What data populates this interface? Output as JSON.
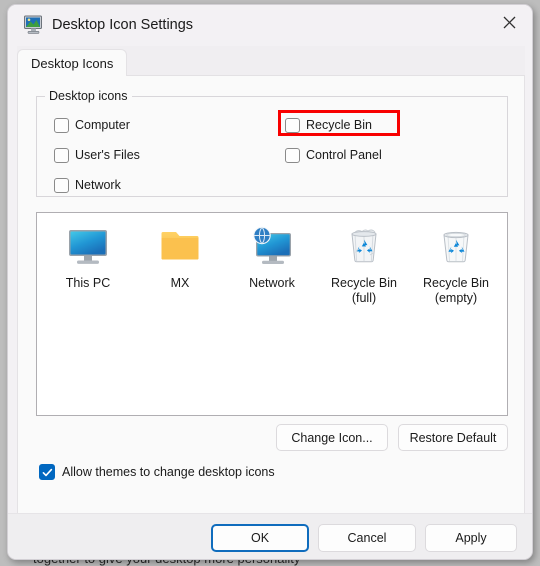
{
  "backdrop": {
    "clipped_text": "together to give your desktop more personality"
  },
  "window": {
    "title": "Desktop Icon Settings",
    "title_icon": "display-properties-monitor-icon",
    "close_icon": "close-icon",
    "close_tooltip": "Close"
  },
  "tabs": [
    {
      "label": "Desktop Icons",
      "selected": true
    }
  ],
  "group": {
    "legend": "Desktop icons",
    "checkboxes": [
      {
        "label": "Computer",
        "checked": false,
        "column": "left",
        "row": 0
      },
      {
        "label": "User's Files",
        "checked": false,
        "column": "left",
        "row": 1
      },
      {
        "label": "Network",
        "checked": false,
        "column": "left",
        "row": 2
      },
      {
        "label": "Recycle Bin",
        "checked": false,
        "column": "right",
        "row": 0,
        "highlighted": true
      },
      {
        "label": "Control Panel",
        "checked": false,
        "column": "right",
        "row": 1
      }
    ]
  },
  "annotation": {
    "target": "Recycle Bin",
    "color": "#f80000"
  },
  "preview": {
    "items": [
      {
        "icon": "this-pc-monitor-icon",
        "label_line1": "This PC",
        "label_line2": ""
      },
      {
        "icon": "folder-icon",
        "label_line1": "MX",
        "label_line2": ""
      },
      {
        "icon": "network-globe-monitor-icon",
        "label_line1": "Network",
        "label_line2": ""
      },
      {
        "icon": "recycle-bin-full-icon",
        "label_line1": "Recycle Bin",
        "label_line2": "(full)"
      },
      {
        "icon": "recycle-bin-empty-icon",
        "label_line1": "Recycle Bin",
        "label_line2": "(empty)"
      }
    ]
  },
  "actions": {
    "change_icon": "Change Icon...",
    "restore_default": "Restore Default"
  },
  "allow_themes": {
    "label": "Allow themes to change desktop icons",
    "checked": true,
    "accent": "#0067c0"
  },
  "footer": {
    "ok": "OK",
    "cancel": "Cancel",
    "apply": "Apply",
    "default_focus": "OK",
    "focus_color": "#0f6cbd"
  }
}
